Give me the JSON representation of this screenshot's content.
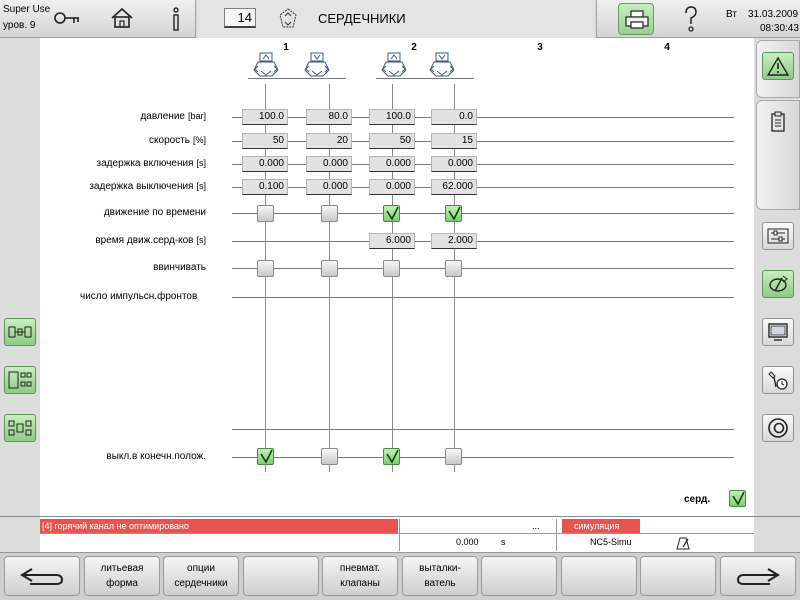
{
  "header": {
    "user_name": "Super Use",
    "user_level": "уров. 9",
    "page_number": "14",
    "page_title": "СЕРДЕЧНИКИ",
    "day": "Вт",
    "date": "31.03.2009",
    "time": "08:30:43"
  },
  "columns": [
    "1",
    "2",
    "3",
    "4"
  ],
  "rows": {
    "pressure": {
      "label": "давление",
      "unit": "[bar]",
      "values": [
        "100.0",
        "80.0",
        "100.0",
        "0.0"
      ]
    },
    "speed": {
      "label": "скорость",
      "unit": "[%]",
      "values": [
        "50",
        "20",
        "50",
        "15"
      ]
    },
    "delay_on": {
      "label": "задержка включения",
      "unit": "[s]",
      "values": [
        "0.000",
        "0.000",
        "0.000",
        "0.000"
      ]
    },
    "delay_off": {
      "label": "задержка выключения",
      "unit": "[s]",
      "values": [
        "0.100",
        "0.000",
        "0.000",
        "62.000"
      ]
    },
    "timed_motion": {
      "label": "движение по времени",
      "checked": [
        false,
        false,
        true,
        true
      ]
    },
    "core_move_time": {
      "label": "время движ.серд-ков",
      "unit": "[s]",
      "values": [
        "6.000",
        "2.000"
      ]
    },
    "screw_in": {
      "label": "ввинчивать",
      "checked": [
        false,
        false,
        false,
        false
      ]
    },
    "pulse_edges": {
      "label": "число импульсн.фронтов"
    },
    "end_position_off": {
      "label": "выкл.в конечн.полож.",
      "checked": [
        true,
        false,
        true,
        false
      ]
    }
  },
  "cores_toggle": {
    "label": "серд.",
    "checked": true
  },
  "status": {
    "alarm": "[4] горячий канал не оптимировано",
    "ellipsis": "...",
    "simulation": "симуляция",
    "value": "0.000",
    "unit": "s",
    "machine": "NC5-Simu"
  },
  "softkeys": [
    {
      "line1": "",
      "line2": ""
    },
    {
      "line1": "литьевая",
      "line2": "форма"
    },
    {
      "line1": "опции",
      "line2": "сердечники"
    },
    {
      "line1": "",
      "line2": ""
    },
    {
      "line1": "пневмат.",
      "line2": "клапаны"
    },
    {
      "line1": "выталки-",
      "line2": "ватель"
    },
    {
      "line1": "",
      "line2": ""
    },
    {
      "line1": "",
      "line2": ""
    },
    {
      "line1": "",
      "line2": ""
    },
    {
      "line1": "",
      "line2": ""
    }
  ],
  "colors": {
    "alarm_red": "#e85450",
    "accent_green": "#8ecc84"
  }
}
